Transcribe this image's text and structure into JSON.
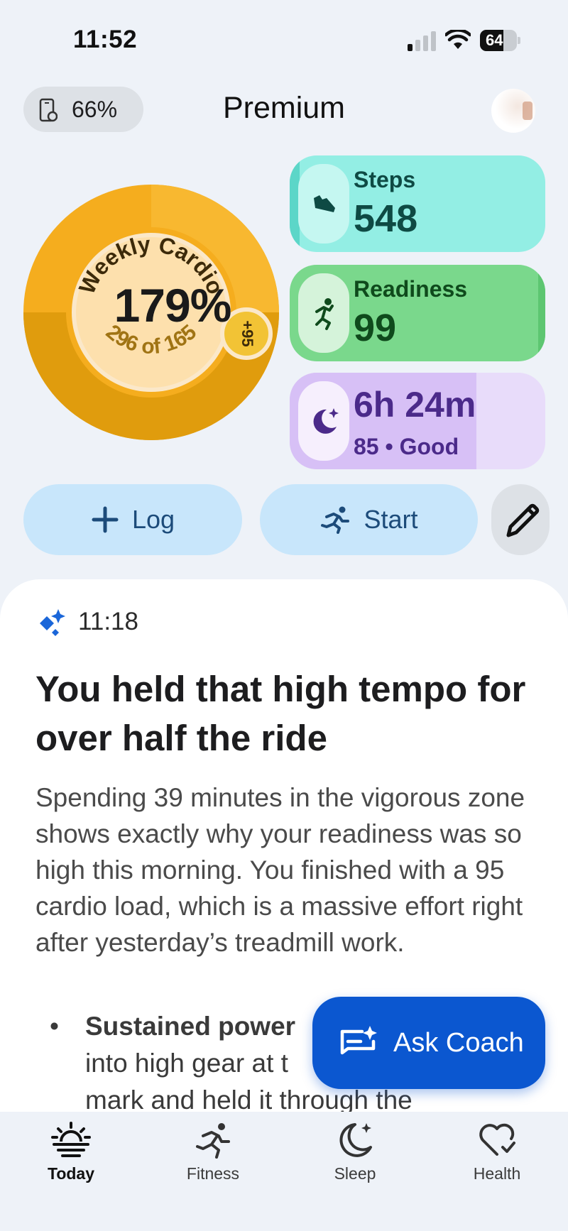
{
  "status_bar": {
    "time": "11:52",
    "battery_level": "64",
    "battery_fraction": 0.64
  },
  "header": {
    "device_battery": "66%",
    "title": "Premium"
  },
  "cardio": {
    "label": "Weekly Cardio",
    "percent": "179%",
    "progress_text": "296 of 165",
    "bonus": "+95",
    "value": 296,
    "goal": 165
  },
  "tiles": {
    "steps": {
      "label": "Steps",
      "value": "548",
      "icon": "shoe-icon"
    },
    "readiness": {
      "label": "Readiness",
      "value": "99",
      "icon": "running-figure-icon"
    },
    "sleep": {
      "value": "6h 24m",
      "score": "85",
      "separator": "•",
      "quality": "Good",
      "icon": "moon-icon",
      "fill_fraction": 0.73
    }
  },
  "actions": {
    "log_label": "Log",
    "start_label": "Start"
  },
  "insight": {
    "time": "11:18",
    "headline": "You held that high tempo for over half the ride",
    "body": "Spending 39 minutes in the vigorous zone shows exactly why your readiness was so high this morning. You finished with a 95 cardio load, which is a massive effort right after yesterday’s treadmill work.",
    "bullet_bold": "Sustained power",
    "bullet_line2": "into high gear at t",
    "bullet_line3": "mark and held it through the"
  },
  "coach": {
    "label": "Ask Coach"
  },
  "nav": [
    {
      "label": "Today",
      "icon": "sunrise-icon",
      "active": true
    },
    {
      "label": "Fitness",
      "icon": "running-icon",
      "active": false
    },
    {
      "label": "Sleep",
      "icon": "moon-star-icon",
      "active": false
    },
    {
      "label": "Health",
      "icon": "heart-check-icon",
      "active": false
    }
  ],
  "colors": {
    "cardio_ring": "#f5ad1e",
    "steps_tile": "#93eee4",
    "readiness_tile": "#7ad88c",
    "sleep_tile": "#d7c0f6",
    "coach_button": "#0b57d0",
    "action_button": "#c8e6fb"
  }
}
